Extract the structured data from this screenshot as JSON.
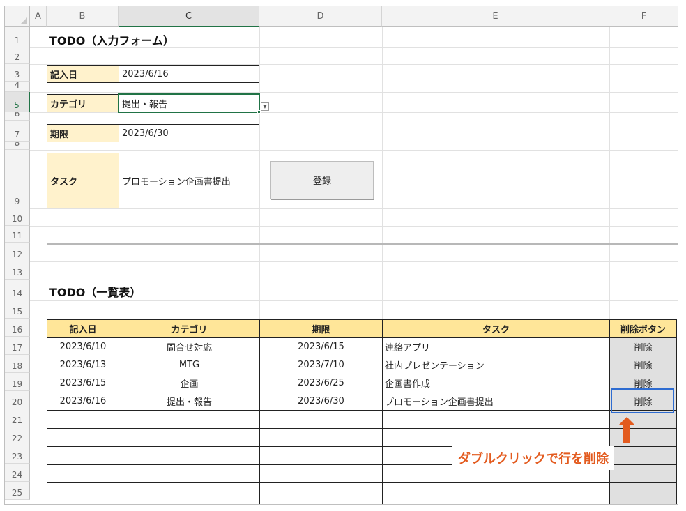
{
  "columns": [
    "A",
    "B",
    "C",
    "D",
    "E",
    "F"
  ],
  "rows": [
    "1",
    "2",
    "3",
    "4",
    "5",
    "6",
    "7",
    "8",
    "9",
    "10",
    "11",
    "12",
    "13",
    "14",
    "15",
    "16",
    "17",
    "18",
    "19",
    "20",
    "21",
    "22",
    "23",
    "24",
    "25"
  ],
  "form": {
    "title": "TODO（入力フォーム）",
    "date_label": "記入日",
    "date_value": "2023/6/16",
    "category_label": "カテゴリ",
    "category_value": "提出・報告",
    "deadline_label": "期限",
    "deadline_value": "2023/6/30",
    "task_label": "タスク",
    "task_value": "プロモーション企画書提出",
    "register_button": "登録"
  },
  "list": {
    "title": "TODO（一覧表）",
    "headers": [
      "記入日",
      "カテゴリ",
      "期限",
      "タスク",
      "削除ボタン"
    ],
    "rows": [
      [
        "2023/6/10",
        "問合せ対応",
        "2023/6/15",
        "連絡アプリ",
        "削除"
      ],
      [
        "2023/6/13",
        "MTG",
        "2023/7/10",
        "社内プレゼンテーション",
        "削除"
      ],
      [
        "2023/6/15",
        "企画",
        "2023/6/25",
        "企画書作成",
        "削除"
      ],
      [
        "2023/6/16",
        "提出・報告",
        "2023/6/30",
        "プロモーション企画書提出",
        "削除"
      ]
    ]
  },
  "annotation": {
    "callout": "ダブルクリックで行を削除",
    "color": "#e35b1f"
  },
  "colors": {
    "label_fill": "#fff2cc",
    "header_fill": "#ffe699",
    "delete_fill": "#e0e0e0",
    "selection": "#217346",
    "highlight": "#2e6cd1"
  }
}
